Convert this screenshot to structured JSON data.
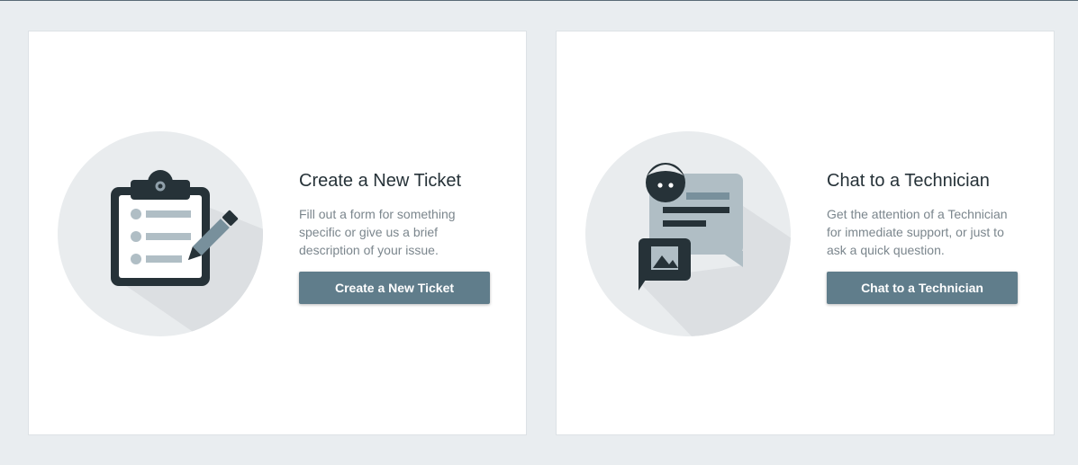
{
  "cards": [
    {
      "title": "Create a New Ticket",
      "description": "Fill out a form for something specific or give us a brief description of your issue.",
      "button_label": "Create a New Ticket",
      "icon": "clipboard-icon"
    },
    {
      "title": "Chat to a Technician",
      "description": "Get the attention of a Technician for immediate support, or just to ask a quick question.",
      "button_label": "Chat to a Technician",
      "icon": "chat-icon"
    }
  ],
  "colors": {
    "background": "#e9edf0",
    "card": "#ffffff",
    "button": "#607d8b",
    "icon_dark": "#263238",
    "icon_circle": "#e9ecee"
  }
}
